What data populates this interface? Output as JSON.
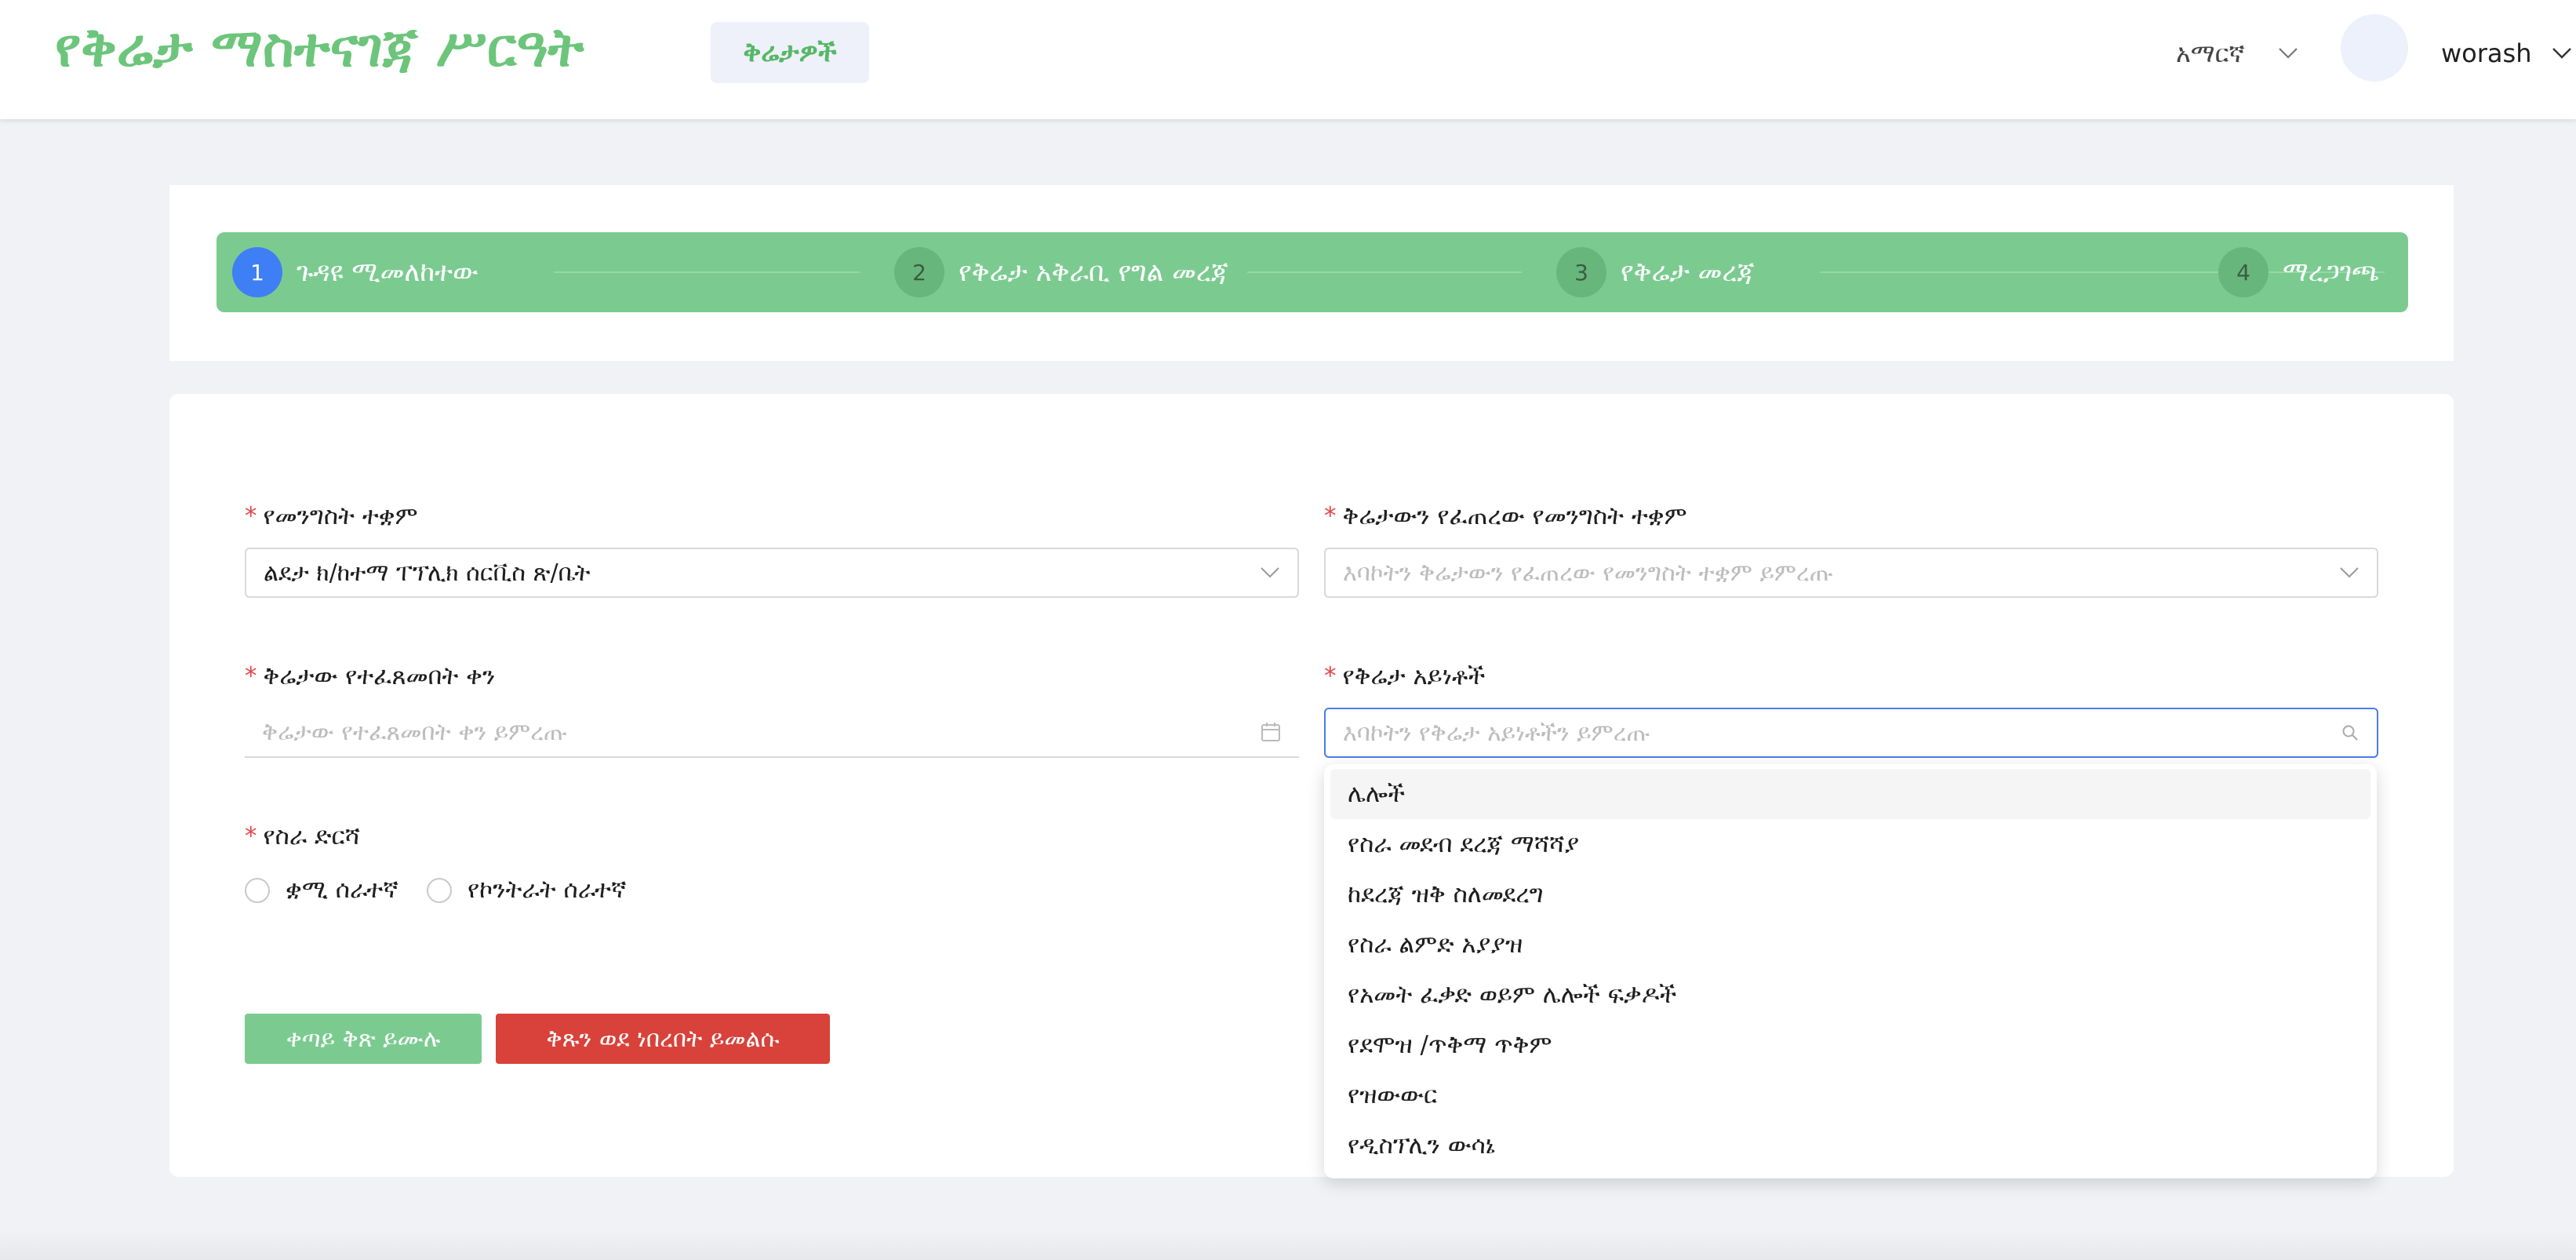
{
  "header": {
    "app_title": "የቅሬታ ማስተናገጃ ሥርዓት",
    "nav_button": "ቅሬታዎች",
    "language": "አማርኛ",
    "username": "worash"
  },
  "steps": [
    {
      "number": "1",
      "label": "ጉዳዩ ሚመለከተው",
      "active": true
    },
    {
      "number": "2",
      "label": "የቅሬታ አቅራቢ የግል መረጃ",
      "active": false
    },
    {
      "number": "3",
      "label": "የቅሬታ መረጃ",
      "active": false
    },
    {
      "number": "4",
      "label": "ማረጋገጫ",
      "active": false
    }
  ],
  "form": {
    "gov_institution": {
      "label": "የመንግስት ተቋም",
      "value": "ልደታ ክ/ከተማ ፐፕሊክ ሰርቪስ ጽ/ቤት"
    },
    "complaint_institution": {
      "label": "ቅሬታውን የፈጠረው የመንግስት ተቋም",
      "placeholder": "እባኮትን ቅሬታውን የፈጠረው የመንግስት ተቋም ይምረጡ"
    },
    "complaint_date": {
      "label": "ቅሬታው የተፈጸመበት ቀን",
      "placeholder": "ቅሬታው የተፈጸመበት ቀን ይምረጡ"
    },
    "complaint_types": {
      "label": "የቅሬታ አይነቶች",
      "placeholder": "እባኮትን የቅሬታ አይነቶችን ይምረጡ"
    },
    "work_level": {
      "label": "የስራ ድርሻ",
      "options": [
        "ቋሚ ሰራተኛ",
        "የኮንትራት ሰራተኛ"
      ]
    },
    "next_button": "ቀጣይ ቅጽ ይሙሉ",
    "back_button": "ቅጹን ወደ ነበረበት ይመልሱ"
  },
  "dropdown": {
    "items": [
      "ሌሎች",
      "የስራ መደብ ደረጃ ማሻሻያ",
      "ከደረጃ ዝቅ ስለመደረግ",
      "የስራ ልምድ አያያዝ",
      "የአመት ፈቃድ ወይም ሌሎች ፍቃዶች",
      "የደሞዝ /ጥቅማ ጥቅም",
      "የዝውውር",
      "የዲስፕሊን ውሳኔ"
    ]
  },
  "colors": {
    "brand_green": "#6cc57b",
    "step_bar": "#7bcb90",
    "active_step": "#3f7ff5",
    "danger": "#d8423a",
    "focus": "#4a7de8"
  }
}
